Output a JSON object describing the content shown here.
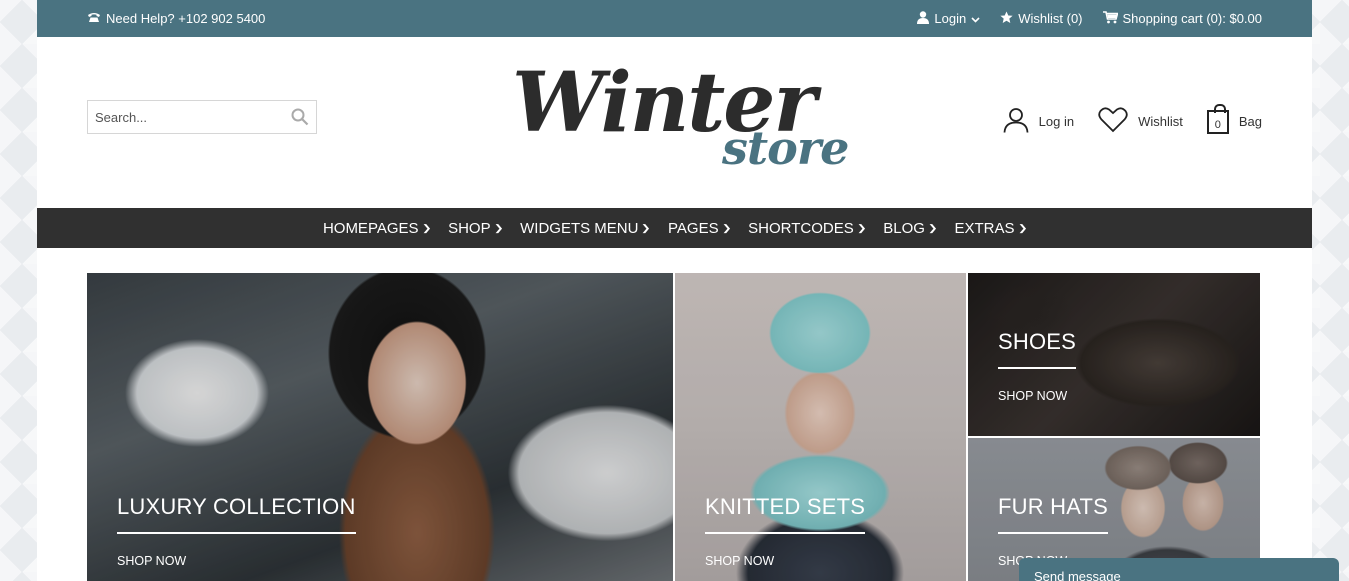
{
  "topbar": {
    "help": "Need Help? +102 902 5400",
    "login": "Login",
    "wishlist": "Wishlist (0)",
    "cart": "Shopping cart (0): $0.00"
  },
  "header": {
    "search_placeholder": "Search...",
    "logo_word1": "Winter",
    "logo_word2": "store",
    "login_label": "Log in",
    "wishlist_label": "Wishlist",
    "bag_count": "0",
    "bag_label": "Bag"
  },
  "nav": {
    "items": [
      "HOMEPAGES",
      "SHOP",
      "WIDGETS MENU",
      "PAGES",
      "SHORTCODES",
      "BLOG",
      "EXTRAS"
    ]
  },
  "banners": [
    {
      "title": "LUXURY COLLECTION",
      "cta": "SHOP NOW"
    },
    {
      "title": "KNITTED SETS",
      "cta": "SHOP NOW"
    },
    {
      "title": "SHOES",
      "cta": "SHOP NOW"
    },
    {
      "title": "FUR HATS",
      "cta": "SHOP NOW"
    }
  ],
  "chat": {
    "label": "Send message"
  },
  "colors": {
    "accent": "#4a7381",
    "nav_bg": "#303030"
  }
}
